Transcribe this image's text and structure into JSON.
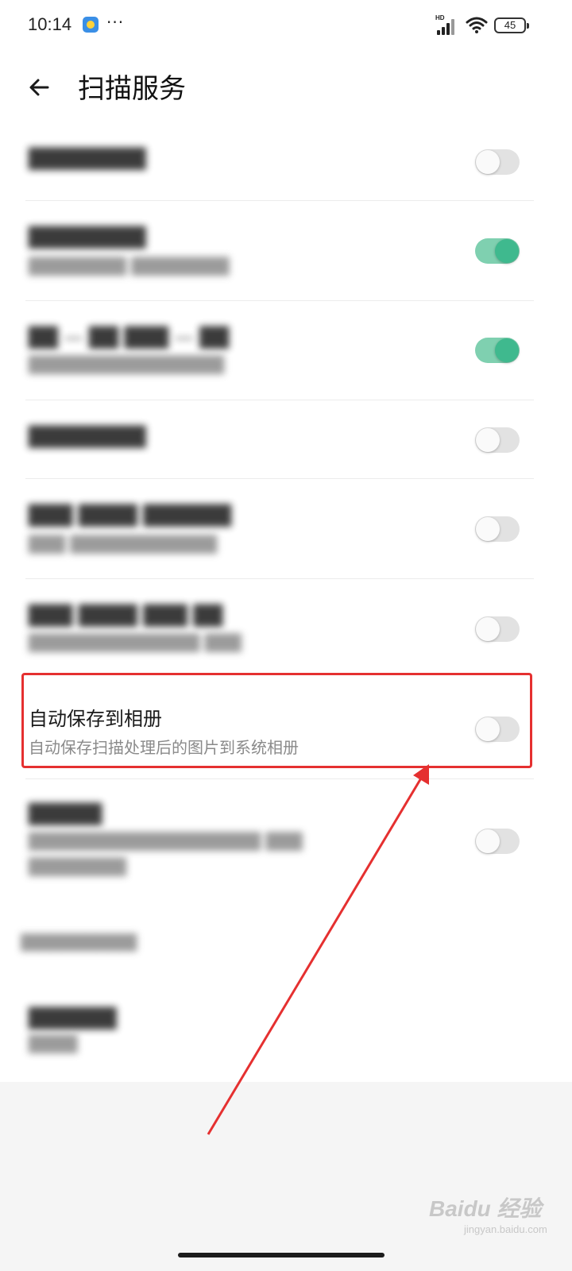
{
  "status_bar": {
    "time": "10:14",
    "more": "···",
    "network": "HD",
    "battery": "45"
  },
  "header": {
    "title": "扫描服务"
  },
  "rows": [
    {
      "title": "████████",
      "subtitle": "",
      "toggle": "off",
      "obscured": true
    },
    {
      "title": "████████ ",
      "subtitle": "████████ ████████",
      "toggle": "on",
      "obscured": true
    },
    {
      "title": "██ — ██ ███ — ██",
      "subtitle": "████████████████",
      "toggle": "on",
      "obscured": true
    },
    {
      "title": "████████",
      "subtitle": "",
      "toggle": "off",
      "obscured": true
    },
    {
      "title": "███ ████ ██████",
      "subtitle": "███ ████████████",
      "toggle": "off",
      "obscured": true
    },
    {
      "title": "███ ████ ███ ██",
      "subtitle": "██████████████ ███",
      "toggle": "off",
      "obscured": true
    },
    {
      "title": "自动保存到相册",
      "subtitle": "自动保存扫描处理后的图片到系统相册",
      "toggle": "off",
      "obscured": false
    },
    {
      "title": "█████",
      "subtitle": "███████████████████ ███",
      "subtitle2": "████████",
      "toggle": "off",
      "obscured": true
    }
  ],
  "section": {
    "label": "██████████"
  },
  "default_row": {
    "title": "██████",
    "subtitle": "████"
  },
  "watermark": {
    "brand": "Baidu 经验",
    "url": "jingyan.baidu.com"
  },
  "colors": {
    "toggle_on": "#3fb98e",
    "toggle_off": "#e2e2e2",
    "highlight": "#e53030"
  }
}
